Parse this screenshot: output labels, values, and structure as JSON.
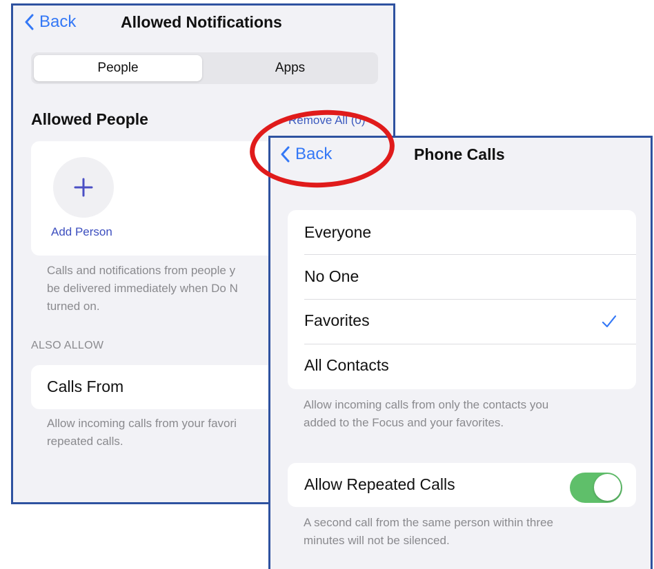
{
  "left_panel": {
    "back_label": "Back",
    "title": "Allowed Notifications",
    "tabs": [
      {
        "label": "People",
        "selected": true
      },
      {
        "label": "Apps",
        "selected": false
      }
    ],
    "allowed_people_title": "Allowed People",
    "remove_all_label": "Remove All (0)",
    "add_person_label": "Add Person",
    "people_description": "Calls and notifications from people y\nbe delivered immediately when Do N\nturned on.",
    "also_allow_header": "ALSO ALLOW",
    "calls_from_label": "Calls From",
    "calls_from_description": "Allow incoming calls from your favori\nrepeated calls."
  },
  "right_panel": {
    "back_label": "Back",
    "title": "Phone Calls",
    "options": [
      {
        "label": "Everyone",
        "selected": false
      },
      {
        "label": "No One",
        "selected": false
      },
      {
        "label": "Favorites",
        "selected": true
      },
      {
        "label": "All Contacts",
        "selected": false
      }
    ],
    "options_description": "Allow incoming calls from only the contacts you\nadded to the Focus and your favorites.",
    "repeated_calls_label": "Allow Repeated Calls",
    "repeated_calls_enabled": true,
    "repeated_calls_description": "A second call from the same person within three\nminutes will not be silenced."
  },
  "colors": {
    "accent": "#3478f6",
    "toggle_on": "#5fbf6a",
    "panel_border": "#2e52a0",
    "highlight": "#e01b1b"
  },
  "icons": [
    "chevron-left-icon",
    "plus-icon",
    "checkmark-icon"
  ]
}
